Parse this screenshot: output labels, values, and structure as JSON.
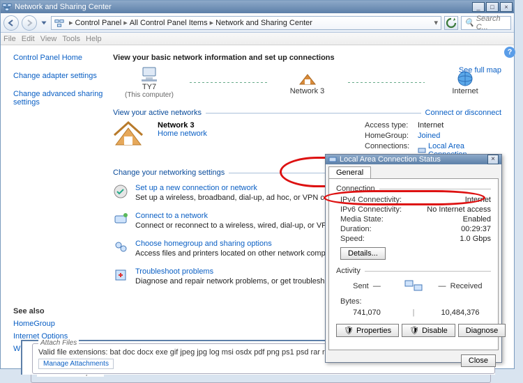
{
  "title_main": "Network and Sharing Center",
  "breadcrumb": {
    "b1": "Control Panel",
    "b2": "All Control Panel Items",
    "b3": "Network and Sharing Center"
  },
  "search_placeholder": "Search C...",
  "menubar": {
    "file": "File",
    "edit": "Edit",
    "view": "View",
    "tools": "Tools",
    "help": "Help"
  },
  "sidebar": {
    "cph": "Control Panel Home",
    "cas": "Change adapter settings",
    "cass": "Change advanced sharing settings",
    "seealso_h": "See also",
    "sa": {
      "hg": "HomeGroup",
      "io": "Internet Options",
      "wf": "Windows Firewall"
    }
  },
  "main_h": "View your basic network information and set up connections",
  "map_link": "See full map",
  "nodes": {
    "n1": "TY7",
    "n1s": "(This computer)",
    "n2": "Network 3",
    "n3": "Internet"
  },
  "sec_active": {
    "l": "View your active networks",
    "a": "Connect or disconnect"
  },
  "active": {
    "name": "Network 3",
    "type": "Home network",
    "k1": "Access type:",
    "v1": "Internet",
    "k2": "HomeGroup:",
    "v2": "Joined",
    "k3": "Connections:",
    "v3": "Local Area Connection"
  },
  "sec_change": "Change your networking settings",
  "tasks": {
    "t1": {
      "t": "Set up a new connection or network",
      "d": "Set up a wireless, broadband, dial-up, ad hoc, or VPN connection; or set up ..."
    },
    "t2": {
      "t": "Connect to a network",
      "d": "Connect or reconnect to a wireless, wired, dial-up, or VPN network connecti..."
    },
    "t3": {
      "t": "Choose homegroup and sharing options",
      "d": "Access files and printers located on other network computers, or change sha..."
    },
    "t4": {
      "t": "Troubleshoot problems",
      "d": "Diagnose and repair network problems, or get troubleshooting information."
    }
  },
  "attach": {
    "legend": "Attach Files",
    "ext": "Valid file extensions: bat doc docx exe gif jpeg jpg log msi osdx pdf png ps1 psd rar reg txt vb",
    "mng": "Manage Attachments",
    "ts": "Thread Subscription"
  },
  "status": {
    "title": "Local Area Connection Status",
    "tab": "General",
    "grp_conn": "Connection",
    "grp_act": "Activity",
    "k1": "IPv4 Connectivity:",
    "v1": "Internet",
    "k2": "IPv6 Connectivity:",
    "v2": "No Internet access",
    "k3": "Media State:",
    "v3": "Enabled",
    "k4": "Duration:",
    "v4": "00:29:37",
    "k5": "Speed:",
    "v5": "1.0 Gbps",
    "details": "Details...",
    "sent": "Sent",
    "recv": "Received",
    "bytes_l": "Bytes:",
    "bytes_s": "741,070",
    "bytes_r": "10,484,376",
    "b_prop": "Properties",
    "b_dis": "Disable",
    "b_diag": "Diagnose",
    "close": "Close"
  }
}
